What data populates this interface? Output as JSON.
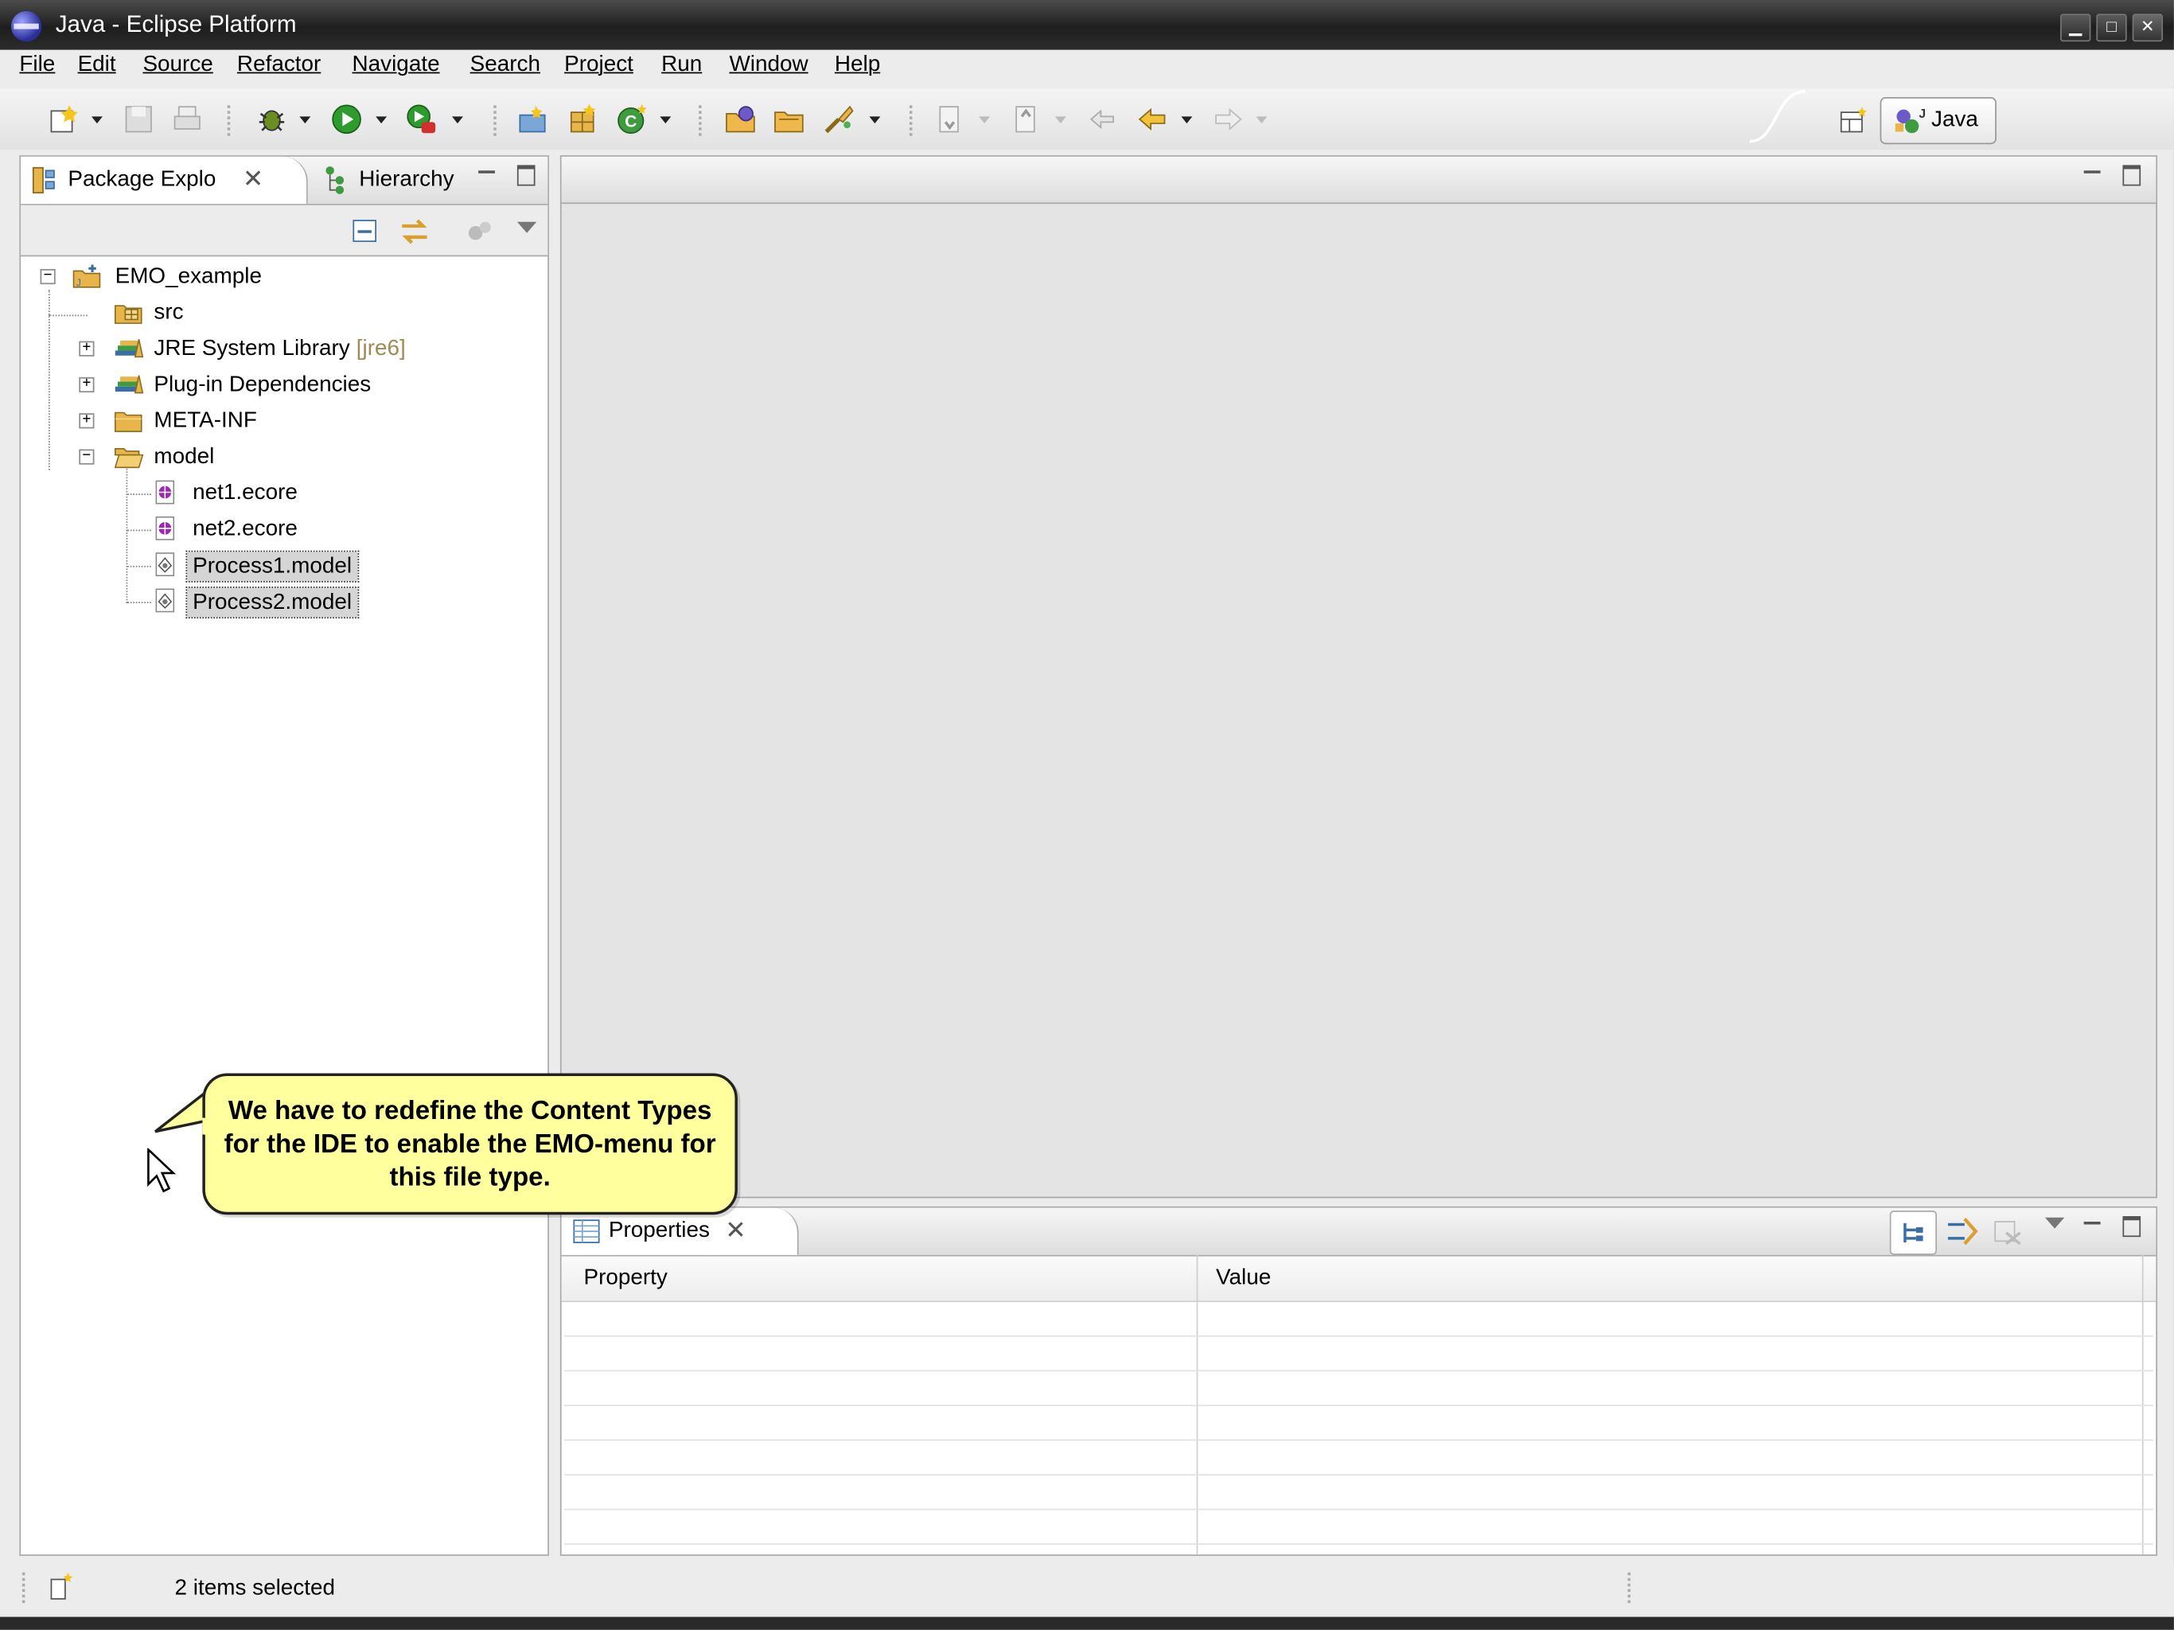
{
  "window": {
    "title": "Java - Eclipse Platform",
    "minimize_glyph": "▁",
    "maximize_glyph": "□",
    "close_glyph": "✕"
  },
  "menu": {
    "items": [
      "File",
      "Edit",
      "Source",
      "Refactor",
      "Navigate",
      "Search",
      "Project",
      "Run",
      "Window",
      "Help"
    ]
  },
  "toolbar": {
    "icons": [
      "new-wizard-icon",
      "save-icon",
      "print-icon",
      "debug-icon",
      "run-icon",
      "external-tools-icon",
      "new-java-project-icon",
      "new-java-package-icon",
      "new-java-class-icon",
      "open-type-icon",
      "open-task-icon",
      "search-icon",
      "next-annotation-icon",
      "previous-annotation-icon",
      "last-edit-location-icon",
      "back-icon",
      "forward-icon"
    ]
  },
  "perspective": {
    "open_perspective_icon": "open-perspective-icon",
    "active_label": "Java"
  },
  "package_explorer": {
    "tabs": [
      "Package Explo",
      "Hierarchy"
    ],
    "tree": {
      "project": "EMO_example",
      "src": "src",
      "jre_label": "JRE System Library",
      "jre_decoration": "[jre6]",
      "plugin_deps": "Plug-in Dependencies",
      "meta_inf": "META-INF",
      "model_folder": "model",
      "files": [
        "net1.ecore",
        "net2.ecore",
        "Process1.model",
        "Process2.model"
      ]
    }
  },
  "properties": {
    "tab_label": "Properties",
    "columns": [
      "Property",
      "Value"
    ]
  },
  "callout": {
    "text": "We have to redefine the Content Types for the IDE to enable the EMO-menu for this file type."
  },
  "status": {
    "text": "2 items selected"
  },
  "colors": {
    "selection": "#d5d5d5",
    "callout_bg": "#ffff9e",
    "decoration": "#a08a55",
    "folder": "#e8b54a"
  }
}
